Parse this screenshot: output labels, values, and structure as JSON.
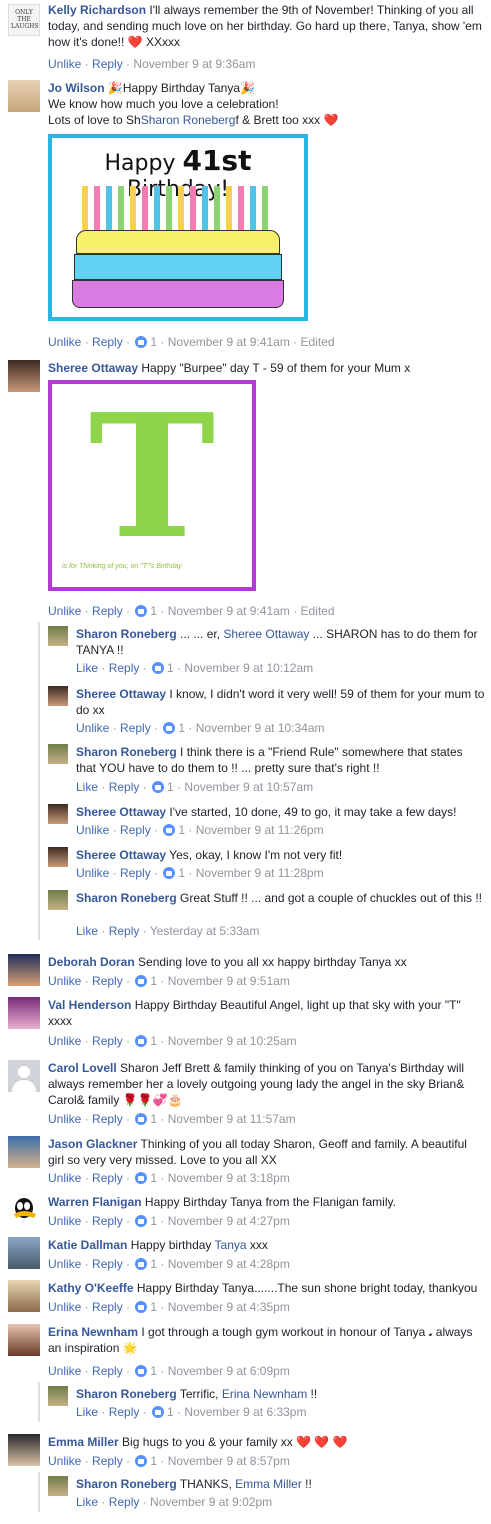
{
  "actions": {
    "unlike": "Unlike",
    "like": "Like",
    "reply": "Reply",
    "sep": " · ",
    "edited": "Edited"
  },
  "comments": [
    {
      "name": "Kelly Richardson",
      "text": "I'll always remember the 9th of November! Thinking of you all today, and sending much love on her birthday. Go hard up there, Tanya, show 'em how it's done!! ❤️ XXxxx",
      "like_label": "Unlike",
      "reactions": "",
      "time": "November 9 at 9:36am"
    },
    {
      "name": "Jo Wilson",
      "pre": "🎉Happy Birthday Tanya🎉",
      "line2": "We know how much you love a celebration!",
      "line3a": "Lots of love to Sh",
      "mention": "Sharon Roneberg",
      "line3b": "f & Brett too xxx ❤️",
      "like_label": "Unlike",
      "reactions": "1",
      "time": "November 9 at 9:41am",
      "edited": "Edited"
    },
    {
      "name": "Sheree Ottaway",
      "text": "Happy \"Burpee\" day T - 59 of them for your Mum x",
      "like_label": "Unlike",
      "reactions": "1",
      "time": "November 9 at 9:41am",
      "edited": "Edited"
    },
    {
      "name": "Deborah Doran",
      "text": "Sending love to you all xx happy birthday Tanya xx",
      "like_label": "Unlike",
      "reactions": "1",
      "time": "November 9 at 9:51am"
    },
    {
      "name": "Val Henderson",
      "text": "Happy Birthday Beautiful Angel, light up that sky with your \"T\" xxxx",
      "like_label": "Unlike",
      "reactions": "1",
      "time": "November 9 at 10:25am"
    },
    {
      "name": "Carol Lovell",
      "text": "Sharon Jeff Brett & family thinking of you on Tanya's Birthday will always remember her a lovely outgoing young lady the angel in the sky Brian& Carol& family 🌹🌹💞🎂",
      "like_label": "Unlike",
      "reactions": "1",
      "time": "November 9 at 11:57am"
    },
    {
      "name": "Jason Glackner",
      "text": "Thinking of you all today Sharon, Geoff and family. A beautiful girl so very very missed. Love to you all XX",
      "like_label": "Unlike",
      "reactions": "1",
      "time": "November 9 at 3:18pm"
    },
    {
      "name": "Warren Flanigan",
      "text": "Happy Birthday Tanya from the Flanigan family.",
      "like_label": "Unlike",
      "reactions": "1",
      "time": "November 9 at 4:27pm"
    },
    {
      "name": "Katie Dallman",
      "text_a": "Happy birthday ",
      "mention": "Tanya",
      "text_b": " xxx",
      "like_label": "Unlike",
      "reactions": "1",
      "time": "November 9 at 4:28pm"
    },
    {
      "name": "Kathy O'Keeffe",
      "text": "Happy Birthday Tanya.......The sun shone bright today, thankyou",
      "like_label": "Unlike",
      "reactions": "1",
      "time": "November 9 at 4:35pm"
    },
    {
      "name": "Erina Newnham",
      "text": "I got through a tough gym workout in honour of Tanya 𝅘 always an inspiration 🌟",
      "like_label": "Unlike",
      "reactions": "1",
      "time": "November 9 at 6:09pm"
    },
    {
      "name": "Emma Miller",
      "text": "Big hugs to you & your family xx ❤️ ❤️ ❤️",
      "like_label": "Unlike",
      "reactions": "1",
      "time": "November 9 at 8:57pm"
    }
  ],
  "replies": [
    {
      "name": "Sharon Roneberg",
      "text_a": "... ... er, ",
      "mention": "Sheree Ottaway",
      "text_b": " ... SHARON has to do them for TANYA !!",
      "like_label": "Like",
      "reactions": "1",
      "time": "November 9 at 10:12am"
    },
    {
      "name": "Sheree Ottaway",
      "text": "I know, I didn't word it very well! 59 of them for your mum to do xx",
      "like_label": "Unlike",
      "reactions": "1",
      "time": "November 9 at 10:34am"
    },
    {
      "name": "Sharon Roneberg",
      "text": "I think there is a \"Friend Rule\" somewhere that states that YOU have to do them to !! ... pretty sure that's right !!",
      "like_label": "Like",
      "reactions": "1",
      "time": "November 9 at 10:57am"
    },
    {
      "name": "Sheree Ottaway",
      "text": "I've started, 10 done, 49 to go, it may take a few days!",
      "like_label": "Unlike",
      "reactions": "1",
      "time": "November 9 at 11:26pm"
    },
    {
      "name": "Sheree Ottaway",
      "text": "Yes, okay, I know I'm not very fit!",
      "like_label": "Unlike",
      "reactions": "1",
      "time": "November 9 at 11:28pm"
    },
    {
      "name": "Sharon Roneberg",
      "text": "Great Stuff !! ... and got a couple of chuckles out of this !!",
      "like_label": "Like",
      "reactions": "",
      "time": "Yesterday at 5:33am"
    },
    {
      "name": "Sharon Roneberg",
      "text_a": "Terrific, ",
      "mention": "Erina Newnham",
      "text_b": " !!",
      "like_label": "Like",
      "reactions": "1",
      "time": "November 9 at 6:33pm"
    },
    {
      "name": "Sharon Roneberg",
      "text_a": "THANKS, ",
      "mention": "Emma Miller",
      "text_b": " !!",
      "like_label": "Like",
      "reactions": "",
      "time": "November 9 at 9:02pm"
    }
  ],
  "cards": {
    "birthday": {
      "title_a": "Happy ",
      "title_num": "41st",
      "title_b": " Birthday!"
    },
    "t_card": {
      "letter": "T",
      "caption": "is for Thinking of you, on \"T\"'s Birthday"
    }
  },
  "kelly_avatar_text": "ONLY THE LAUGHS"
}
